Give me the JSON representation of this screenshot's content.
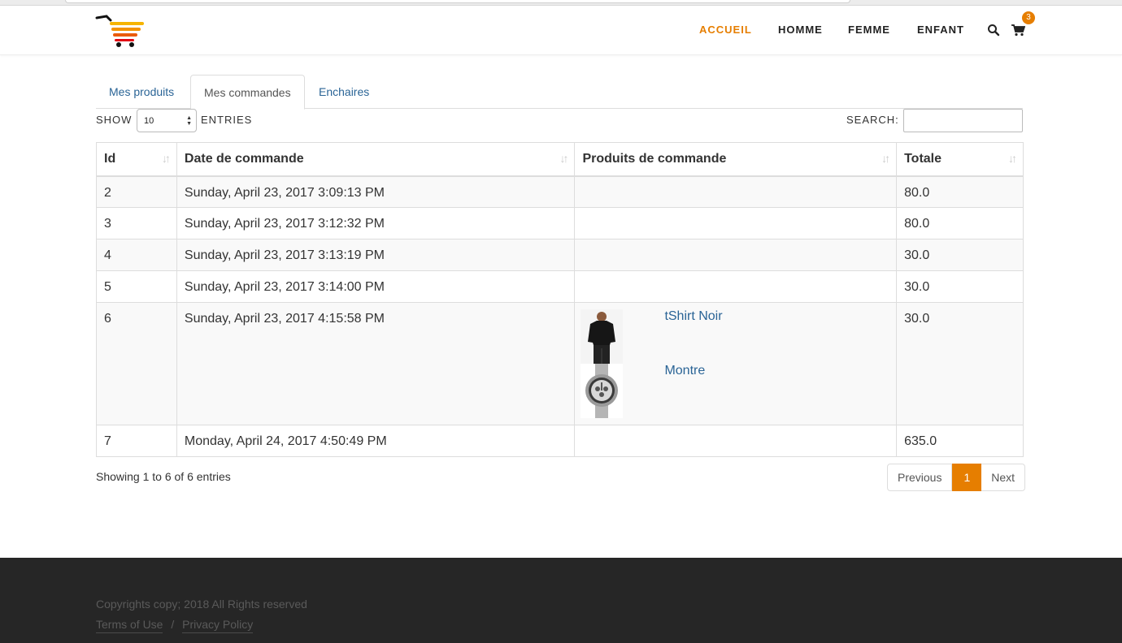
{
  "nav": {
    "items": [
      "ACCUEIL",
      "HOMME",
      "FEMME",
      "ENFANT"
    ],
    "cart_count": "3"
  },
  "tabs": [
    "Mes produits",
    "Mes commandes",
    "Enchaires"
  ],
  "table_controls": {
    "show_label": "SHOW",
    "entries_value": "10",
    "entries_label": "ENTRIES",
    "search_label": "SEARCH:",
    "search_value": ""
  },
  "table": {
    "headers": [
      "Id",
      "Date de commande",
      "Produits de commande",
      "Totale"
    ],
    "rows": [
      {
        "id": "2",
        "date": "Sunday, April 23, 2017 3:09:13 PM",
        "total": "80.0"
      },
      {
        "id": "3",
        "date": "Sunday, April 23, 2017 3:12:32 PM",
        "total": "80.0"
      },
      {
        "id": "4",
        "date": "Sunday, April 23, 2017 3:13:19 PM",
        "total": "30.0"
      },
      {
        "id": "5",
        "date": "Sunday, April 23, 2017 3:14:00 PM",
        "total": "30.0"
      },
      {
        "id": "6",
        "date": "Sunday, April 23, 2017 4:15:58 PM",
        "total": "30.0",
        "products": [
          "tShirt Noir",
          "Montre"
        ]
      },
      {
        "id": "7",
        "date": "Monday, April 24, 2017 4:50:49 PM",
        "total": "635.0"
      }
    ]
  },
  "pagination": {
    "info": "Showing 1 to 6 of 6 entries",
    "previous": "Previous",
    "current": "1",
    "next": "Next"
  },
  "footer": {
    "copyright": "Copyrights copy; 2018 All Rights reserved",
    "terms": "Terms of Use",
    "separator": "/",
    "privacy": "Privacy Policy"
  },
  "colors": {
    "accent": "#e67e00",
    "link": "#2a6496",
    "footer_bg": "#262626"
  }
}
